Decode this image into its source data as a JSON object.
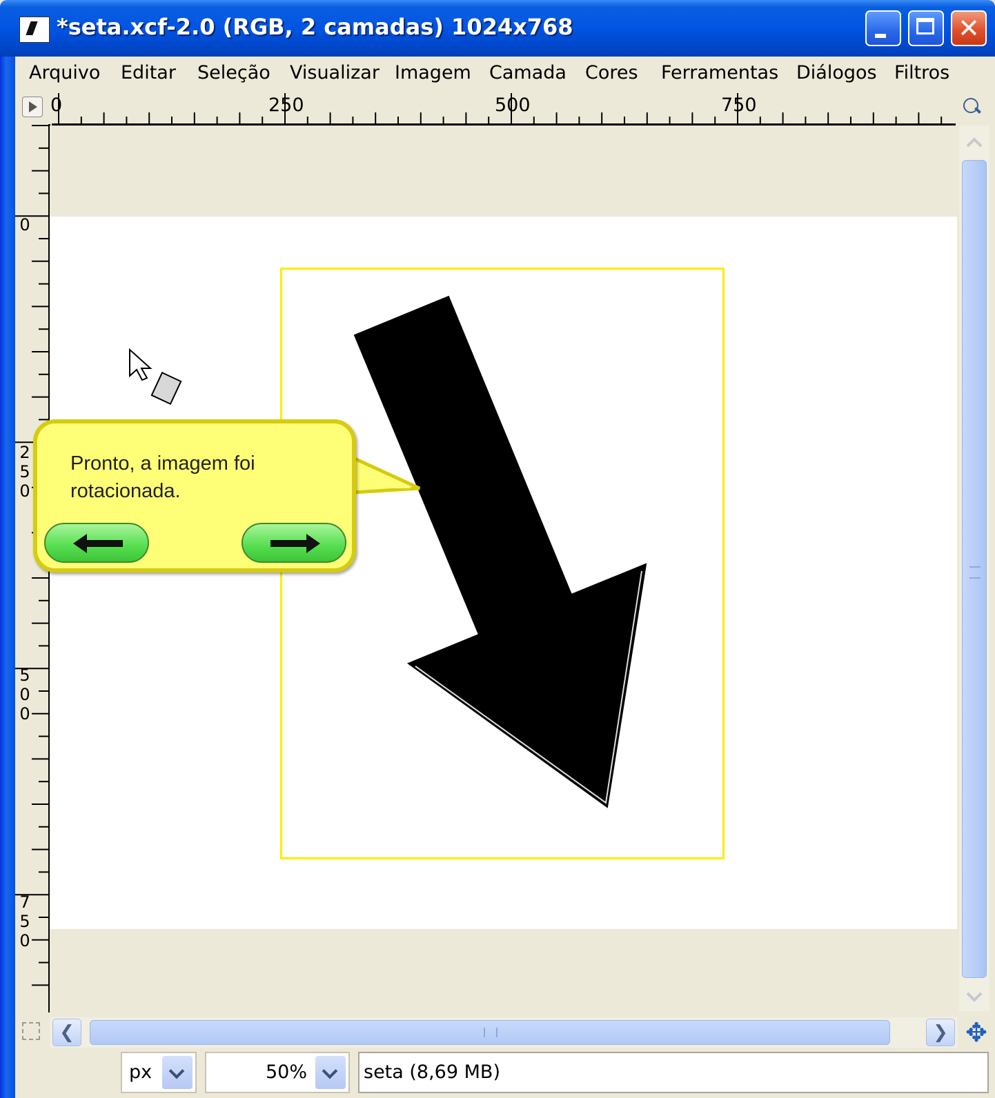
{
  "window": {
    "title": "*seta.xcf-2.0 (RGB, 2 camadas) 1024x768",
    "controls": [
      "minimize",
      "maximize",
      "close"
    ]
  },
  "menu": [
    "Arquivo",
    "Editar",
    "Seleção",
    "Visualizar",
    "Imagem",
    "Camada",
    "Cores",
    "Ferramentas",
    "Diálogos",
    "Filtros"
  ],
  "ruler_top": {
    "labels": [
      "0",
      "250",
      "500",
      "750"
    ]
  },
  "ruler_left": {
    "labels": [
      "0",
      "250",
      "500",
      "750"
    ]
  },
  "tooltip": {
    "text": "Pronto, a imagem foi rotacionada.",
    "prev_icon": "arrow-left-icon",
    "next_icon": "arrow-right-icon"
  },
  "statusbar": {
    "unit": "px",
    "zoom": "50%",
    "info": "seta (8,69 MB)"
  },
  "colors": {
    "title_bar": "#0054e3",
    "canvas": "#ffffff",
    "workspace": "#ece9d8",
    "tooltip_bg": "#ffff77",
    "tooltip_button": "#54de4e",
    "layer_boundary": "#ffeb00",
    "arrow": "#000000"
  }
}
